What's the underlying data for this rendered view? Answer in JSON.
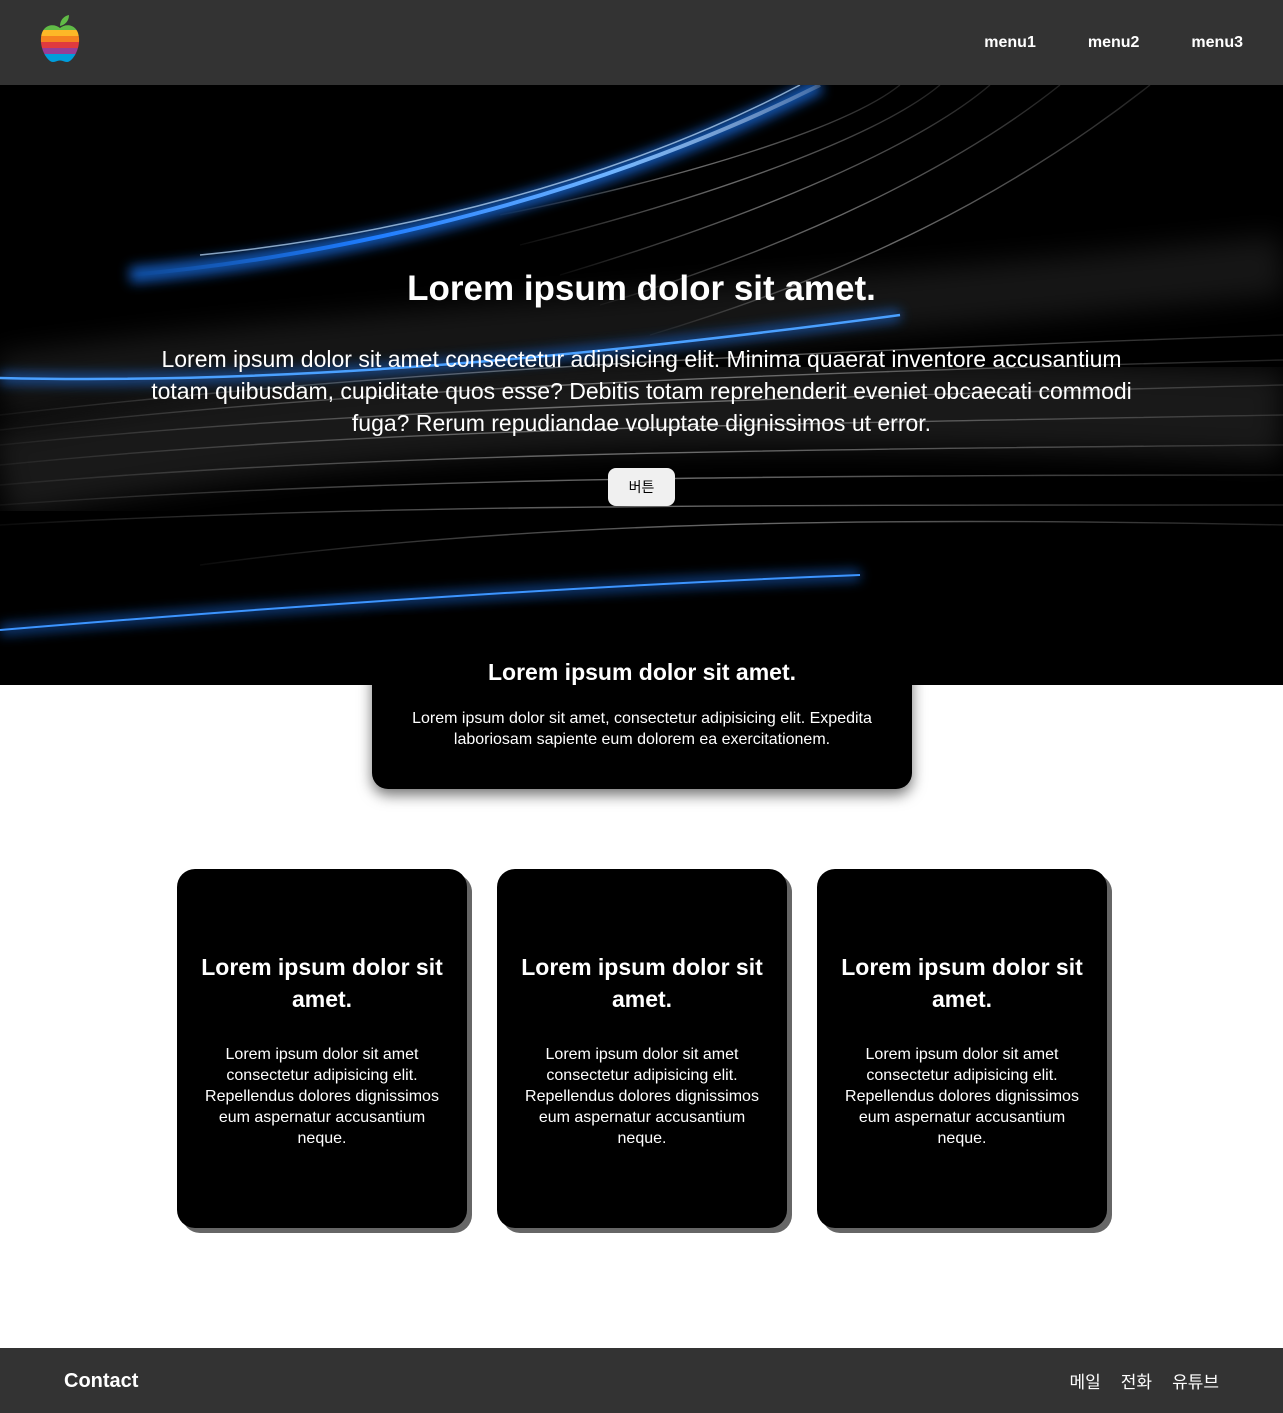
{
  "header": {
    "logo_icon": "rainbow-apple-logo-icon",
    "nav": [
      {
        "label": "menu1"
      },
      {
        "label": "menu2"
      },
      {
        "label": "menu3"
      }
    ]
  },
  "hero": {
    "title": "Lorem ipsum dolor sit amet.",
    "description": "Lorem ipsum dolor sit amet consectetur adipisicing elit. Minima quaerat inventore accusantium totam quibusdam, cupiditate quos esse? Debitis totam reprehenderit eveniet obcaecati commodi fuga? Rerum repudiandae voluptate dignissimos ut error.",
    "button_label": "버튼"
  },
  "feature": {
    "title": "Lorem ipsum dolor sit amet.",
    "text": "Lorem ipsum dolor sit amet, consectetur adipisicing elit. Expedita laboriosam sapiente eum dolorem ea exercitationem."
  },
  "cards": [
    {
      "title": "Lorem ipsum dolor sit amet.",
      "text": "Lorem ipsum dolor sit amet consectetur adipisicing elit. Repellendus dolores dignissimos eum aspernatur accusantium neque."
    },
    {
      "title": "Lorem ipsum dolor sit amet.",
      "text": "Lorem ipsum dolor sit amet consectetur adipisicing elit. Repellendus dolores dignissimos eum aspernatur accusantium neque."
    },
    {
      "title": "Lorem ipsum dolor sit amet.",
      "text": "Lorem ipsum dolor sit amet consectetur adipisicing elit. Repellendus dolores dignissimos eum aspernatur accusantium neque."
    }
  ],
  "footer": {
    "title": "Contact",
    "links": [
      {
        "label": "메일"
      },
      {
        "label": "전화"
      },
      {
        "label": "유튜브"
      }
    ]
  },
  "colors": {
    "header_bg": "#333333",
    "hero_bg": "#000000",
    "accent_blue": "#1e7cff",
    "card_bg": "#000000",
    "card_shadow": "#666666"
  }
}
